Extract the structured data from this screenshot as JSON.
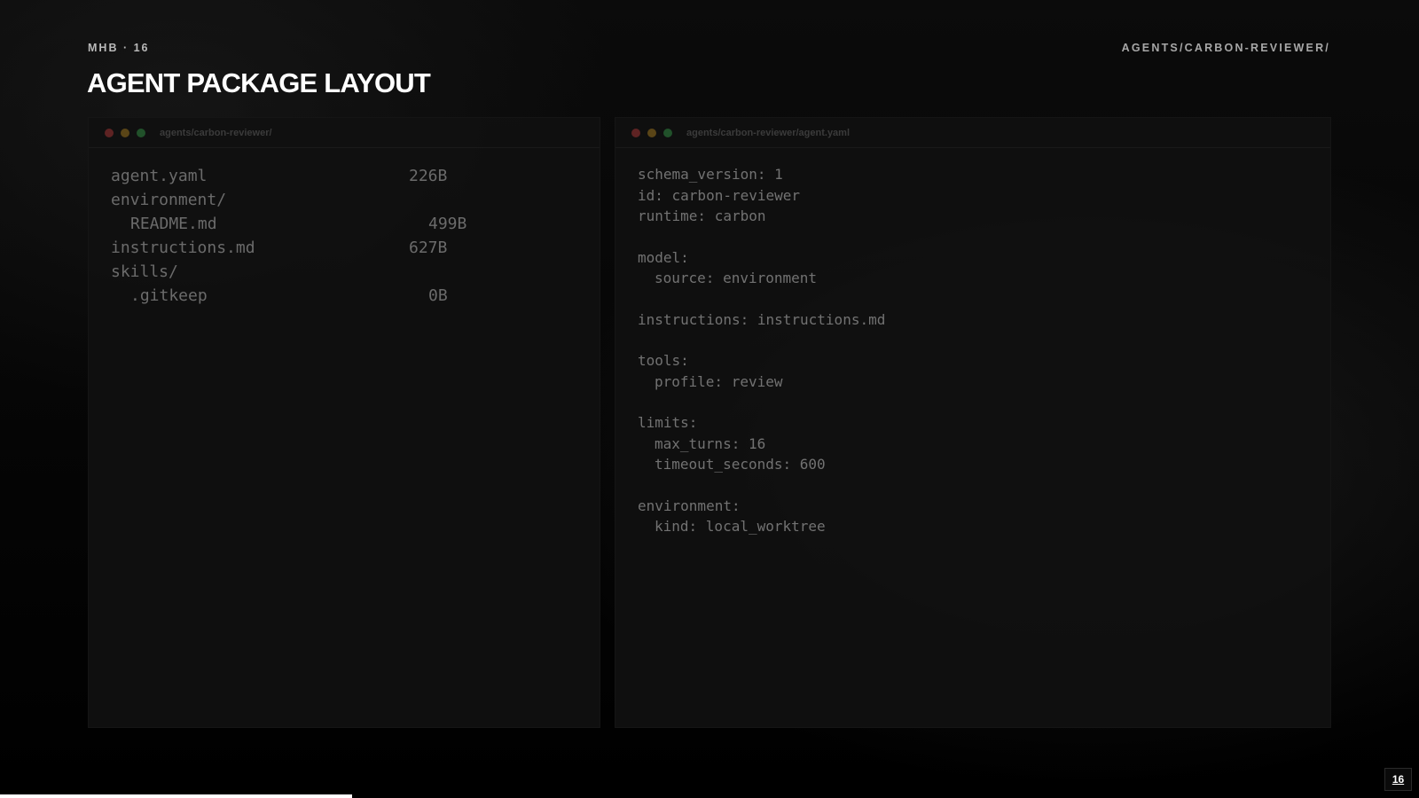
{
  "header": {
    "eyebrow": "MHB · 16",
    "path": "AGENTS/CARBON-REVIEWER/",
    "title": "AGENT PACKAGE LAYOUT"
  },
  "file_tree": {
    "window_title": "agents/carbon-reviewer/",
    "entries": [
      {
        "name": "agent.yaml",
        "size": "226B",
        "depth": 0
      },
      {
        "name": "environment/",
        "size": "",
        "depth": 0
      },
      {
        "name": "README.md",
        "size": "499B",
        "depth": 1
      },
      {
        "name": "instructions.md",
        "size": "627B",
        "depth": 0
      },
      {
        "name": "skills/",
        "size": "",
        "depth": 0
      },
      {
        "name": ".gitkeep",
        "size": "0B",
        "depth": 1
      }
    ]
  },
  "yaml_file": {
    "window_title": "agents/carbon-reviewer/agent.yaml",
    "lines": [
      "schema_version: 1",
      "id: carbon-reviewer",
      "runtime: carbon",
      "",
      "model:",
      "  source: environment",
      "",
      "instructions: instructions.md",
      "",
      "tools:",
      "  profile: review",
      "",
      "limits:",
      "  max_turns: 16",
      "  timeout_seconds: 600",
      "",
      "environment:",
      "  kind: local_worktree"
    ]
  },
  "footer": {
    "page_number": "16",
    "progress_fraction": 0.248
  },
  "colors": {
    "background": "#000000",
    "title": "#ffffff",
    "dot_red": "#5e2323",
    "dot_yellow": "#5a4517",
    "dot_green": "#21512a"
  }
}
